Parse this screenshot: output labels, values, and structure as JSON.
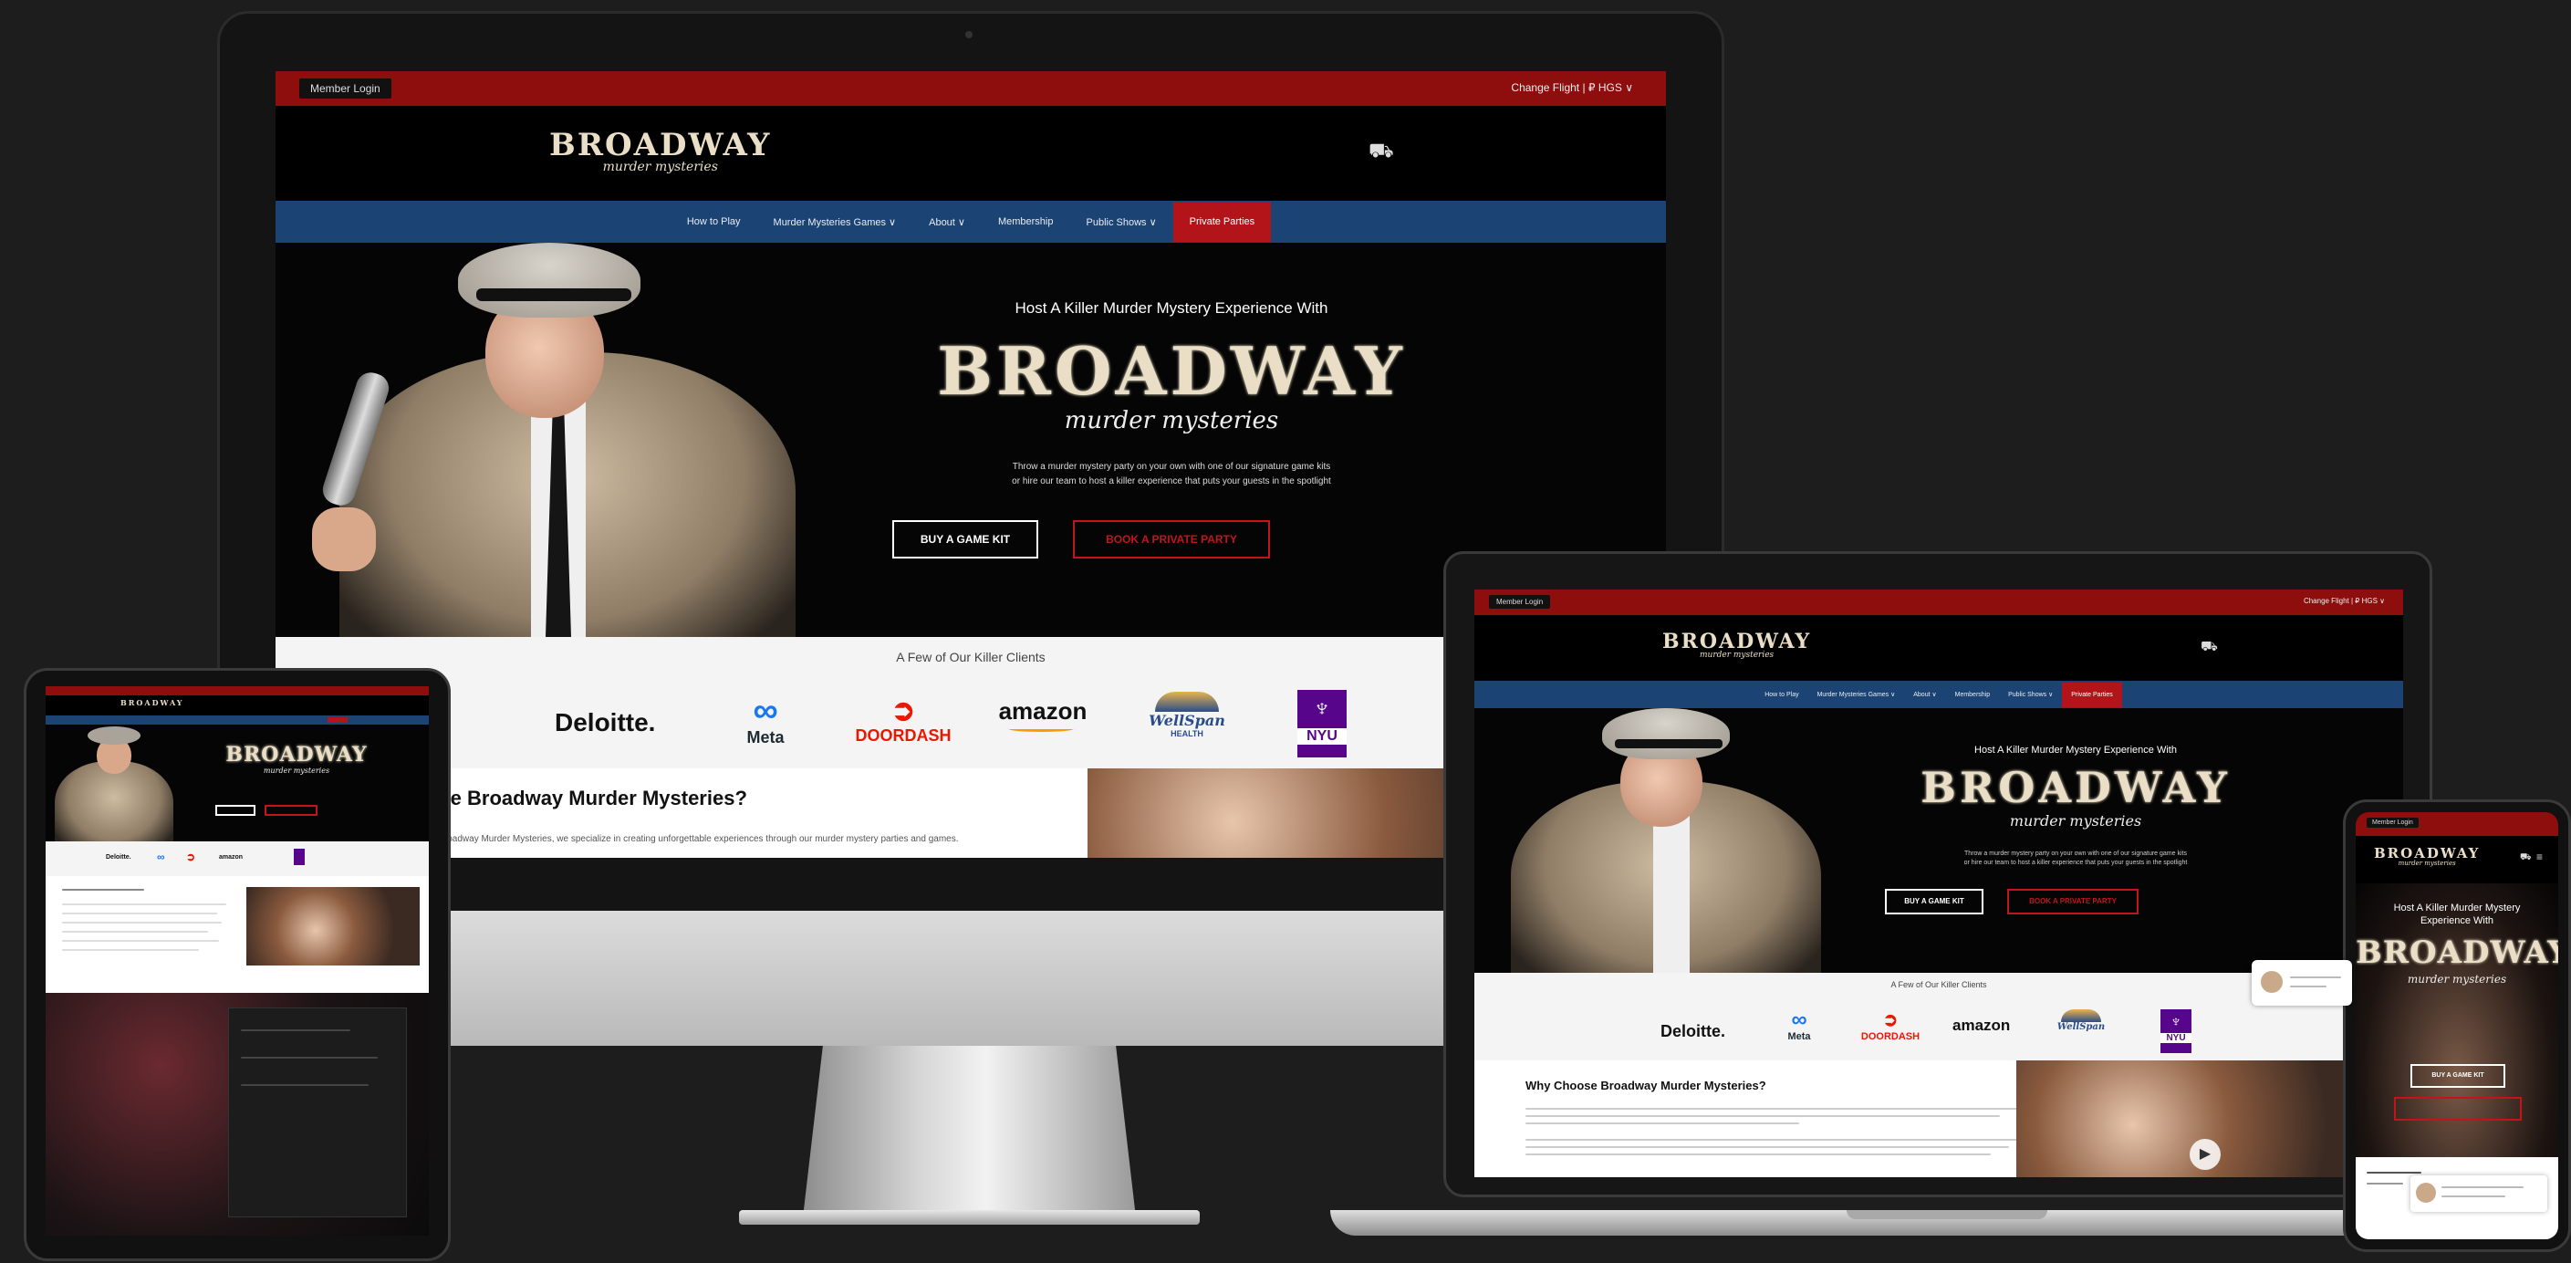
{
  "site": {
    "login": "Member Login",
    "currency": "Change Flight | ₽ HGS ∨",
    "logo_main": "BROADWAY",
    "logo_sub": "murder mysteries",
    "nav": [
      "How to Play",
      "Murder Mysteries Games ∨",
      "About ∨",
      "Membership",
      "Public Shows ∨",
      "Private Parties"
    ],
    "hero_eyebrow": "Host A Killer Murder Mystery Experience With",
    "hero_title": "BROADWAY",
    "hero_script": "murder mysteries",
    "hero_body_1": "Throw a murder mystery party on your own with one of our signature game kits",
    "hero_body_2": "or hire our team to host a killer experience that puts your guests in the spotlight",
    "btn_kit": "BUY A GAME KIT",
    "btn_party": "BOOK A PRIVATE PARTY",
    "clients_title": "A Few of Our Killer Clients",
    "clients": [
      "Deloitte.",
      "Meta",
      "DOORDASH",
      "amazon",
      "WellSpan",
      "NYU"
    ],
    "clients_sub": {
      "wellspan": "HEALTH"
    },
    "why_title": "Why Choose Broadway Murder Mysteries?",
    "why_title_cut": "ose Broadway Murder Mysteries?",
    "why_body": "At Broadway Murder Mysteries, we specialize in creating unforgettable experiences through our murder mystery parties and games."
  },
  "colors": {
    "red": "#8e0d0d",
    "nav_blue": "#1b4373",
    "accent_red": "#c2141b",
    "logo_cream": "#eadfc6"
  }
}
